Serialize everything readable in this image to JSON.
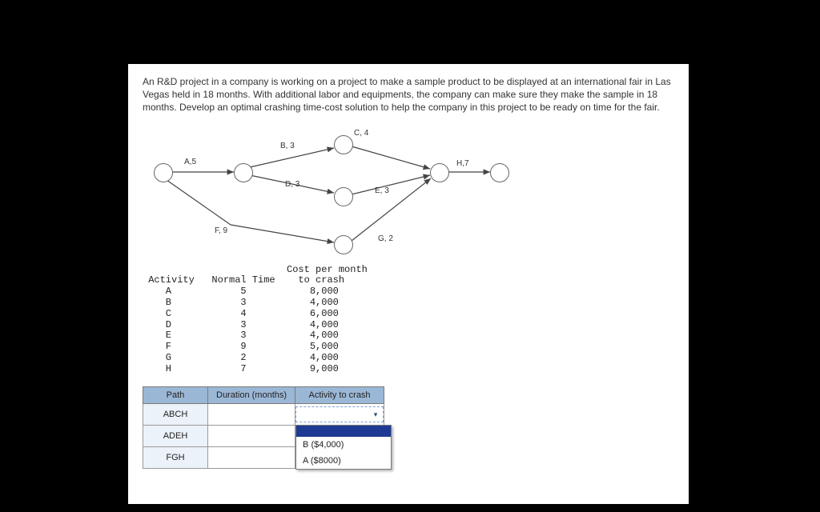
{
  "intro": "An R&D project in a company is working on a project to make a sample product to be displayed at an international fair in Las Vegas held in 18 months. With additional labor and equipments, the company can make sure they make the sample in 18 months. Develop an optimal crashing time-cost solution to help the company in this project to be ready on time for the fair.",
  "diagram": {
    "edges": [
      "A,5",
      "B, 3",
      "C, 4",
      "D, 3",
      "E, 3",
      "F, 9",
      "G, 2",
      "H,7"
    ]
  },
  "table": {
    "header_line1": "                         Cost per month",
    "header_line2": " Activity   Normal Time    to crash",
    "rows": [
      "    A            5           8,000",
      "    B            3           4,000",
      "    C            4           6,000",
      "    D            3           4,000",
      "    E            3           4,000",
      "    F            9           5,000",
      "    G            2           4,000",
      "    H            7           9,000"
    ]
  },
  "path_table": {
    "headers": [
      "Path",
      "Duration (months)",
      "Activity to crash"
    ],
    "rows": [
      {
        "path": "ABCH"
      },
      {
        "path": "ADEH"
      },
      {
        "path": "FGH"
      }
    ],
    "dropdown_options": [
      "B ($4,000)",
      "A ($8000)"
    ]
  },
  "chart_data": {
    "type": "table",
    "title": "Activity crash cost table",
    "columns": [
      "Activity",
      "Normal Time (months)",
      "Cost per month to crash ($)"
    ],
    "rows": [
      [
        "A",
        5,
        8000
      ],
      [
        "B",
        3,
        4000
      ],
      [
        "C",
        4,
        6000
      ],
      [
        "D",
        3,
        4000
      ],
      [
        "E",
        3,
        4000
      ],
      [
        "F",
        9,
        5000
      ],
      [
        "G",
        2,
        4000
      ],
      [
        "H",
        7,
        9000
      ]
    ]
  }
}
